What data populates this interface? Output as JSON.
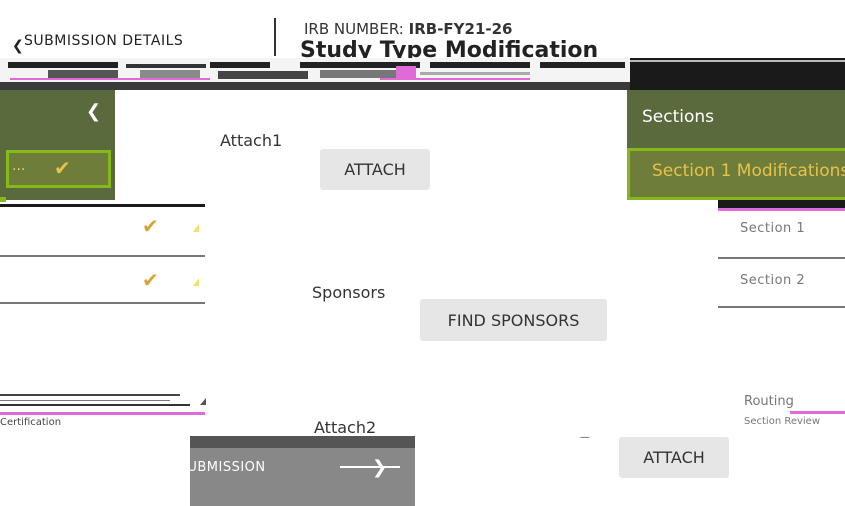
{
  "header": {
    "irb_label": "IRB NUMBER:",
    "irb_value": "IRB-FY21-26",
    "submission_details": "SUBMISSION DETAILS",
    "back_icon": "back-arrow-icon",
    "page_title_garbled": "Study Type Modification"
  },
  "left_sidebar": {
    "collapse_icon": "chevron-left-icon",
    "active_item_ellipsis": "...",
    "check_icon": "check-icon",
    "bottom_text": "Certification"
  },
  "form": {
    "attach1_label": "Attach1",
    "attach1_button": "ATTACH",
    "sponsors_label": "Sponsors",
    "find_sponsors_button": "FIND SPONSORS",
    "attach2_label": "Attach2",
    "attach2_button": "ATTACH",
    "complete_submission_button": "COMPLETE SUBMISSION"
  },
  "sections_panel": {
    "title": "Sections",
    "active_item": "Section 1 Modifications",
    "items": [
      "Section 1",
      "Section 2"
    ],
    "bottom_item": "Routing",
    "bottom_sub": "Section Review"
  },
  "colors": {
    "panel_green": "#5a6a3c",
    "active_border": "#86b81c",
    "check_gold": "#d4a637",
    "button_gray": "#e6e6e6"
  }
}
